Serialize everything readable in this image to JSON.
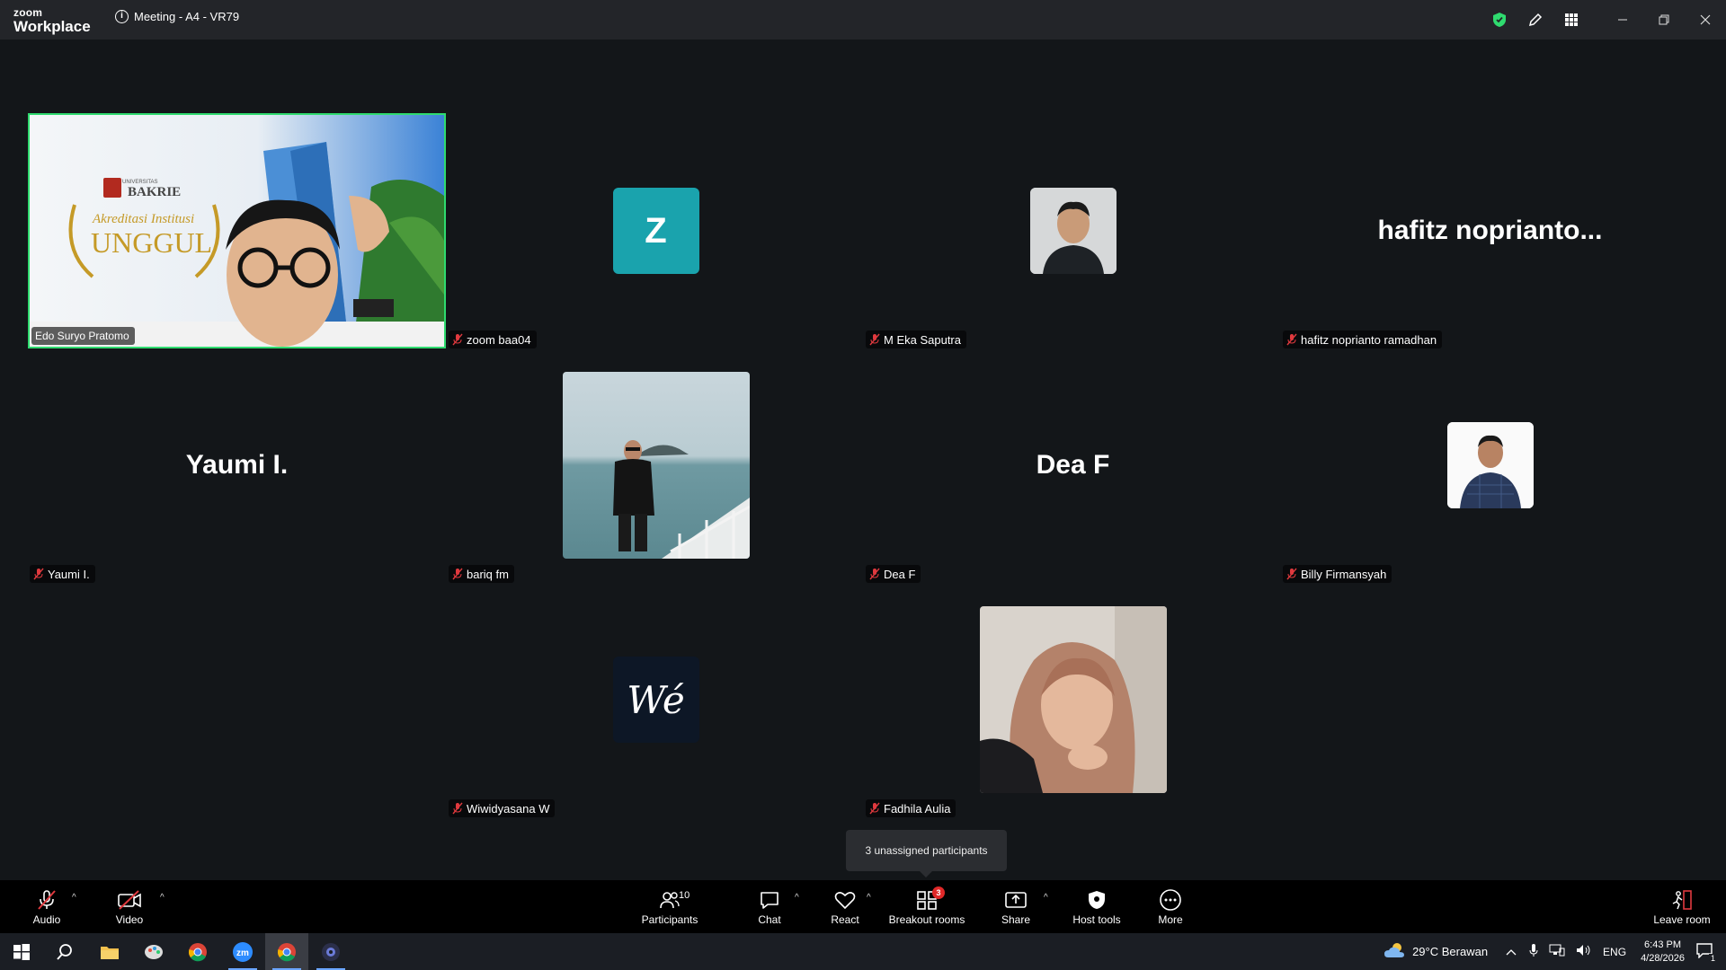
{
  "titlebar": {
    "logo_top": "zoom",
    "logo_bottom": "Workplace",
    "meeting_title": "Meeting - A4 - VR79"
  },
  "tiles": [
    {
      "name": "Edo Suryo Pratomo",
      "kind": "video",
      "muted": false,
      "active": true
    },
    {
      "name": "zoom baa04",
      "kind": "initial",
      "initial": "Z",
      "muted": true
    },
    {
      "name": "M Eka Saputra",
      "kind": "photo-small",
      "muted": true
    },
    {
      "name": "hafitz noprianto ramadhan",
      "kind": "text",
      "display": "hafitz  noprianto...",
      "muted": true
    },
    {
      "name": "Yaumi I.",
      "kind": "text",
      "display": "Yaumi I.",
      "muted": true
    },
    {
      "name": "bariq fm",
      "kind": "photo-large",
      "muted": true
    },
    {
      "name": "Dea F",
      "kind": "text",
      "display": "Dea F",
      "muted": true
    },
    {
      "name": "Billy Firmansyah",
      "kind": "photo-small",
      "muted": true
    },
    {
      "name": "Wiwidyasana W",
      "kind": "logo",
      "logo_text": "Wé",
      "muted": true
    },
    {
      "name": "Fadhila Aulia",
      "kind": "photo-large",
      "muted": true
    }
  ],
  "video_overlay": {
    "brand_small": "UNIVERSITAS",
    "brand": "BAKRIE",
    "accreditation": "Akreditasi Institusi",
    "grade": "UNGGUL"
  },
  "tooltip": "3 unassigned participants",
  "toolbar": {
    "audio": "Audio",
    "video": "Video",
    "participants": "Participants",
    "participants_count": "10",
    "chat": "Chat",
    "react": "React",
    "breakout": "Breakout rooms",
    "breakout_badge": "3",
    "share": "Share",
    "host_tools": "Host tools",
    "more": "More",
    "leave": "Leave room"
  },
  "taskbar": {
    "weather": "29°C  Berawan",
    "lang": "ENG",
    "time": "6:43 PM",
    "date": "4/28/2026",
    "notif_count": "1"
  },
  "colors": {
    "active_border": "#2fdb6f",
    "initial_bg": "#1aa3ad",
    "muted_red": "#e0393e",
    "badge_red": "#e02828",
    "shield_green": "#2fdb6f"
  }
}
